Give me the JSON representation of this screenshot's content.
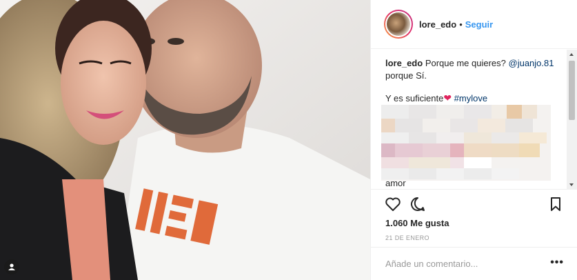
{
  "post": {
    "username": "lore_edo",
    "separator": "•",
    "follow_label": "Seguir"
  },
  "caption": {
    "username": "lore_edo",
    "text_1": "Porque me quieres?",
    "mention": "@juanjo.81",
    "text_2": "porque Sí.",
    "text_3": "Y es suficiente",
    "heart": "❤",
    "hashtag": "#mylove",
    "trailing_word": "amor"
  },
  "stats": {
    "likes": "1.060 Me gusta",
    "date": "21 DE ENERO"
  },
  "comment_box": {
    "placeholder": "Añade un comentario...",
    "more_label": "•••"
  },
  "icons": {
    "like": "heart-icon",
    "comment": "comment-icon",
    "save": "bookmark-icon",
    "tag": "user-tag-icon"
  }
}
